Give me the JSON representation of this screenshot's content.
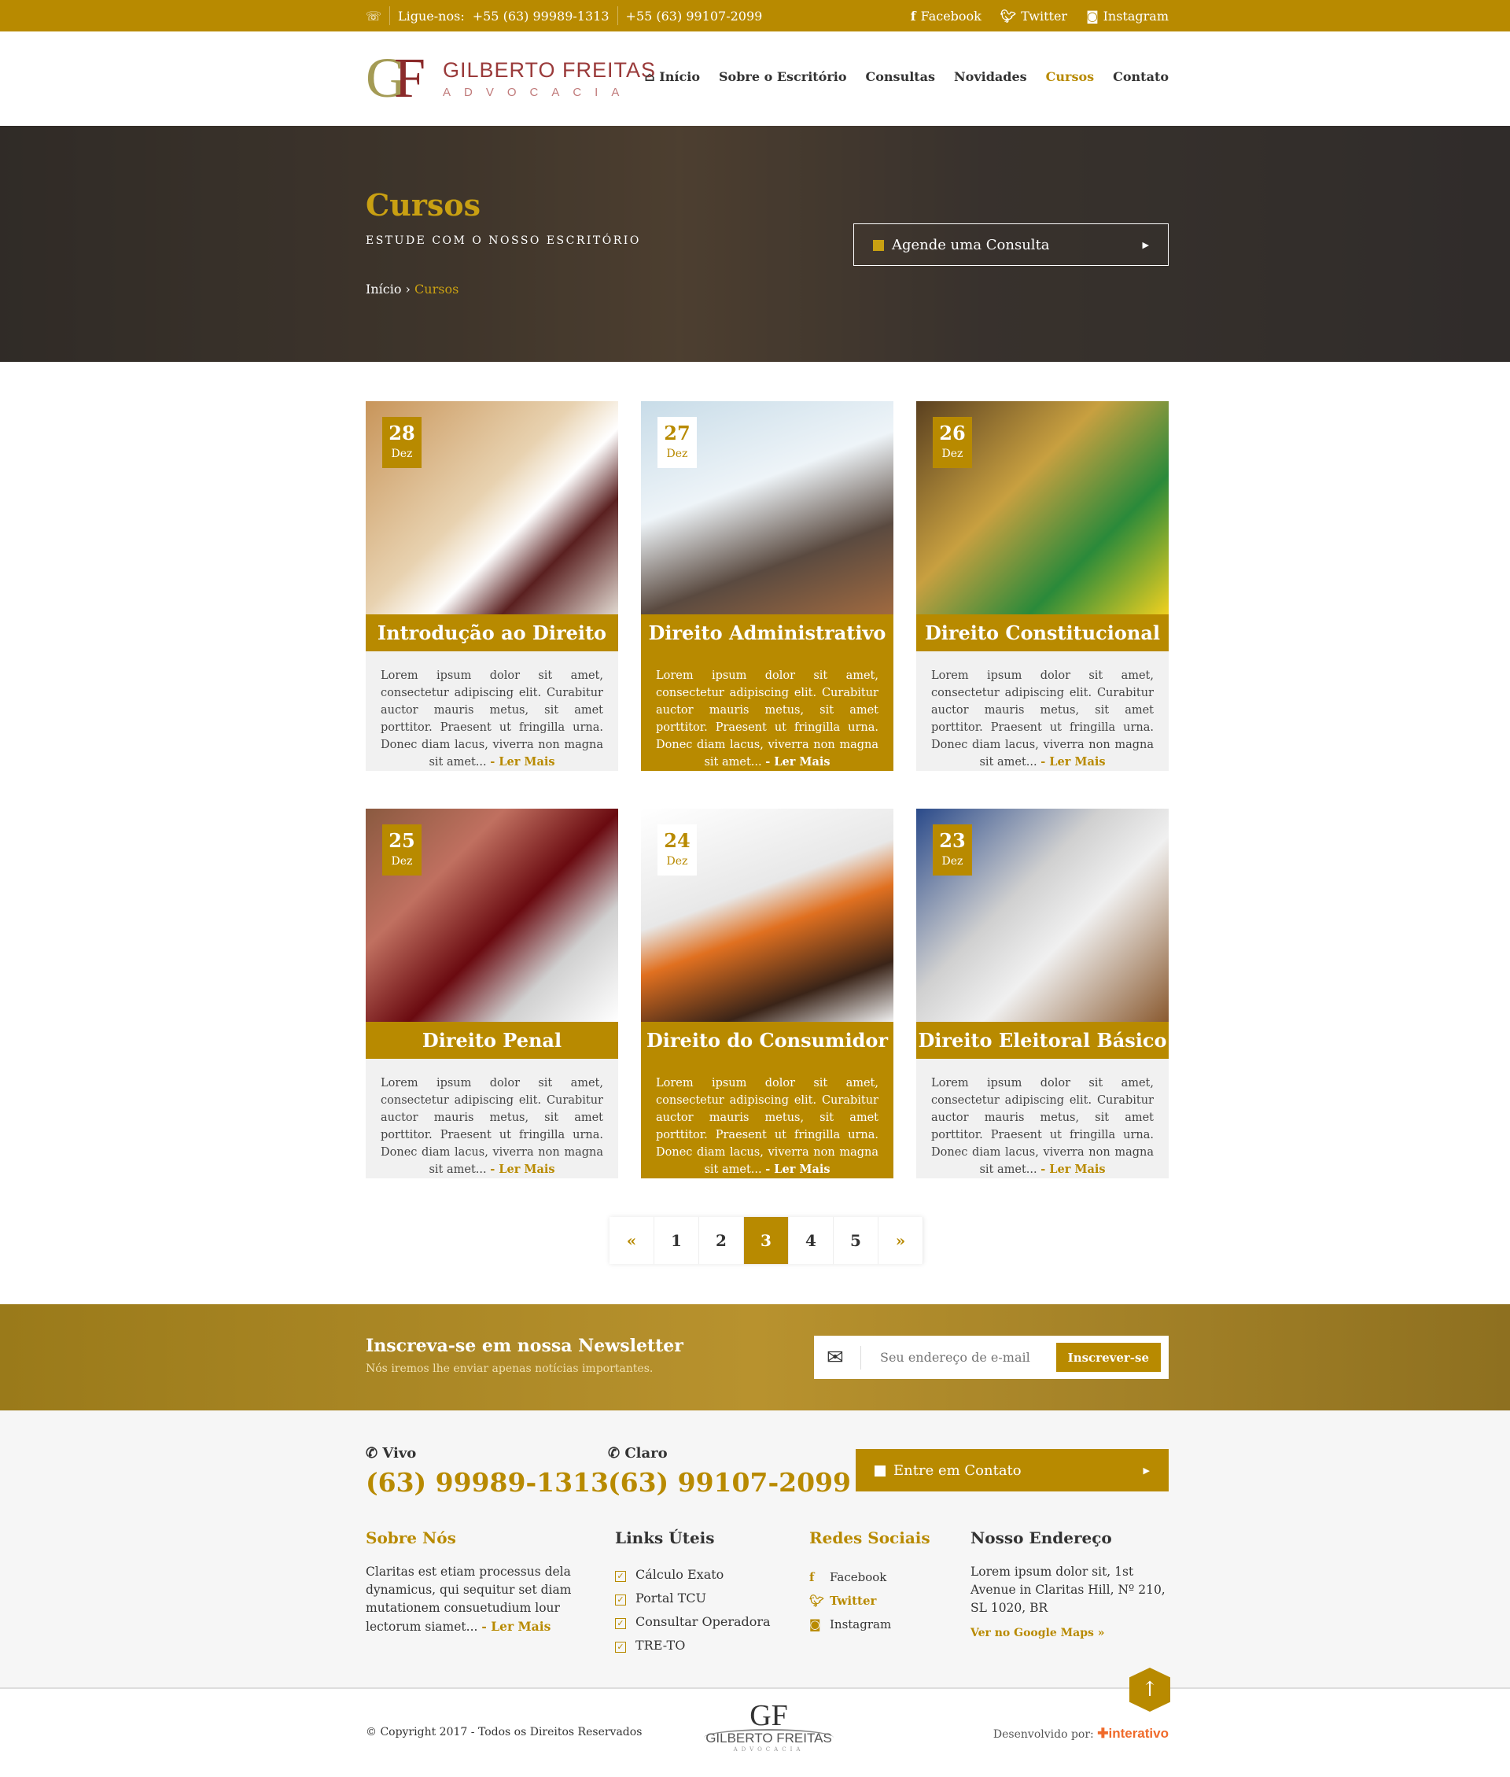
{
  "topbar": {
    "label": "Ligue-nos:",
    "phone1": "+55 (63) 99989-1313",
    "phone2": "+55 (63) 99107-2099",
    "social": [
      "Facebook",
      "Twitter",
      "Instagram"
    ]
  },
  "header": {
    "logo_line1": "GILBERTO FREITAS",
    "logo_line2": "ADVOCACIA",
    "logo_mark": "GF",
    "nav": [
      "Início",
      "Sobre o Escritório",
      "Consultas",
      "Novidades",
      "Cursos",
      "Contato"
    ],
    "active": "Cursos"
  },
  "hero": {
    "title": "Cursos",
    "subtitle": "ESTUDE COM O NOSSO ESCRITÓRIO",
    "breadcrumb": [
      "Início",
      "Cursos"
    ],
    "cta": "Agende uma Consulta"
  },
  "courses": [
    {
      "day": "28",
      "month": "Dez",
      "title": "Introdução ao Direito",
      "text": "Lorem ipsum dolor sit amet, consectetur adipiscing elit. Curabitur auctor mauris metus, sit amet porttitor. Praesent ut fringilla urna. Donec diam lacus, viverra non magna sit amet...",
      "more": "- Ler Mais"
    },
    {
      "day": "27",
      "month": "Dez",
      "title": "Direito Administrativo",
      "text": "Lorem ipsum dolor sit amet, consectetur adipiscing elit. Curabitur auctor mauris metus, sit amet porttitor. Praesent ut fringilla urna. Donec diam lacus, viverra non magna sit amet...",
      "more": "- Ler Mais"
    },
    {
      "day": "26",
      "month": "Dez",
      "title": "Direito Constitucional",
      "text": "Lorem ipsum dolor sit amet, consectetur adipiscing elit. Curabitur auctor mauris metus, sit amet porttitor. Praesent ut fringilla urna. Donec diam lacus, viverra non magna sit amet...",
      "more": "- Ler Mais"
    },
    {
      "day": "25",
      "month": "Dez",
      "title": "Direito Penal",
      "text": "Lorem ipsum dolor sit amet, consectetur adipiscing elit. Curabitur auctor mauris metus, sit amet porttitor. Praesent ut fringilla urna. Donec diam lacus, viverra non magna sit amet...",
      "more": "- Ler Mais"
    },
    {
      "day": "24",
      "month": "Dez",
      "title": "Direito do Consumidor",
      "text": "Lorem ipsum dolor sit amet, consectetur adipiscing elit. Curabitur auctor mauris metus, sit amet porttitor. Praesent ut fringilla urna. Donec diam lacus, viverra non magna sit amet...",
      "more": "- Ler Mais"
    },
    {
      "day": "23",
      "month": "Dez",
      "title": "Direito Eleitoral Básico",
      "text": "Lorem ipsum dolor sit amet, consectetur adipiscing elit. Curabitur auctor mauris metus, sit amet porttitor. Praesent ut fringilla urna. Donec diam lacus, viverra non magna sit amet...",
      "more": "- Ler Mais"
    }
  ],
  "pagination": {
    "prev": "«",
    "pages": [
      "1",
      "2",
      "3",
      "4",
      "5"
    ],
    "current": "3",
    "next": "»"
  },
  "newsletter": {
    "title": "Inscreva-se em nossa Newsletter",
    "subtitle": "Nós iremos lhe enviar apenas notícias importantes.",
    "placeholder": "Seu endereço de e-mail",
    "button": "Inscrever-se"
  },
  "footer": {
    "vivo_label": "Vivo",
    "vivo": "(63) 99989-1313",
    "claro_label": "Claro",
    "claro": "(63) 99107-2099",
    "contact_btn": "Entre em Contato",
    "about_title": "Sobre Nós",
    "about_text": "Claritas est etiam processus dela dynamicus, qui sequitur set diam mutationem consuetudium lour lectorum siamet...",
    "about_more": "- Ler Mais",
    "links_title": "Links Úteis",
    "links": [
      "Cálculo Exato",
      "Portal TCU",
      "Consultar Operadora",
      "TRE-TO"
    ],
    "social_title": "Redes Sociais",
    "social": [
      "Facebook",
      "Twitter",
      "Instagram"
    ],
    "address_title": "Nosso Endereço",
    "address": "Lorem ipsum dolor sit, 1st Avenue in Claritas Hill, Nº 210, SL 1020, BR",
    "maps": "Ver no Google Maps »"
  },
  "bottom": {
    "copyright": "© Copyright 2017 - Todos os Direitos Reservados",
    "dev_label": "Desenvolvido por:",
    "dev_brand": "interativo",
    "logo_line1": "GILBERTO FREITAS",
    "logo_line2": "ADVOCACIA"
  },
  "colors": {
    "accent": "#b88a00"
  }
}
